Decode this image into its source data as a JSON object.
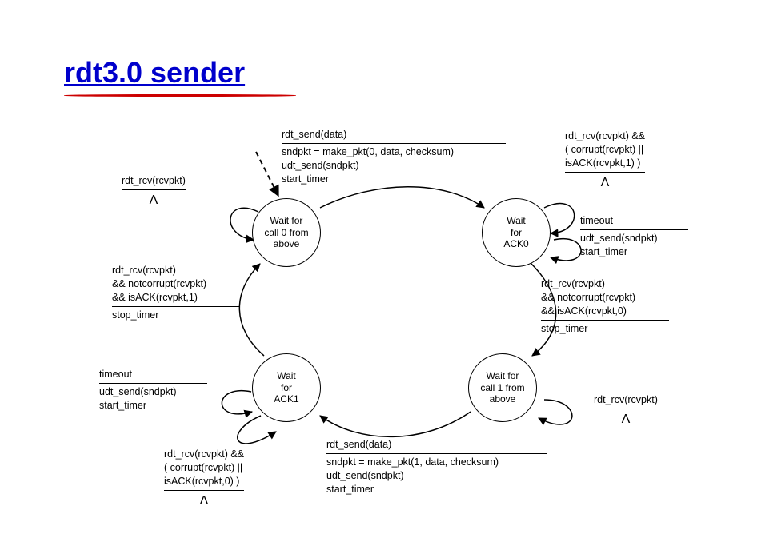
{
  "title": "rdt3.0 sender",
  "states": {
    "s0": "Wait for\ncall 0 from\nabove",
    "s1": "Wait\nfor\nACK0",
    "s2": "Wait for\ncall 1 from\nabove",
    "s3": "Wait\nfor\nACK1"
  },
  "labels": {
    "t_send0_event": "rdt_send(data)",
    "t_send0_act1": "sndpkt = make_pkt(0, data, checksum)",
    "t_send0_act2": "udt_send(sndpkt)",
    "t_send0_act3": "start_timer",
    "ack0_corrupt_e1": "rdt_rcv(rcvpkt) &&",
    "ack0_corrupt_e2": "( corrupt(rcvpkt) ||",
    "ack0_corrupt_e3": "isACK(rcvpkt,1) )",
    "ack0_corrupt_act": "Λ",
    "ack0_timeout_e": "timeout",
    "ack0_timeout_a1": "udt_send(sndpkt)",
    "ack0_timeout_a2": "start_timer",
    "ack0_ok_e1": "rdt_rcv(rcvpkt)",
    "ack0_ok_e2": "&& notcorrupt(rcvpkt)",
    "ack0_ok_e3": "&& isACK(rcvpkt,0)",
    "ack0_ok_a": "stop_timer",
    "s2_idle_e": "rdt_rcv(rcvpkt)",
    "s2_idle_a": "Λ",
    "t_send1_event": "rdt_send(data)",
    "t_send1_act1": "sndpkt = make_pkt(1, data, checksum)",
    "t_send1_act2": "udt_send(sndpkt)",
    "t_send1_act3": "start_timer",
    "ack1_corrupt_e1": "rdt_rcv(rcvpkt) &&",
    "ack1_corrupt_e2": "( corrupt(rcvpkt) ||",
    "ack1_corrupt_e3": "isACK(rcvpkt,0) )",
    "ack1_corrupt_act": "Λ",
    "ack1_timeout_e": "timeout",
    "ack1_timeout_a1": "udt_send(sndpkt)",
    "ack1_timeout_a2": "start_timer",
    "ack1_ok_e1": "rdt_rcv(rcvpkt)",
    "ack1_ok_e2": "&& notcorrupt(rcvpkt)",
    "ack1_ok_e3": "&& isACK(rcvpkt,1)",
    "ack1_ok_a": "stop_timer",
    "s0_idle_e": "rdt_rcv(rcvpkt)",
    "s0_idle_a": "Λ"
  }
}
